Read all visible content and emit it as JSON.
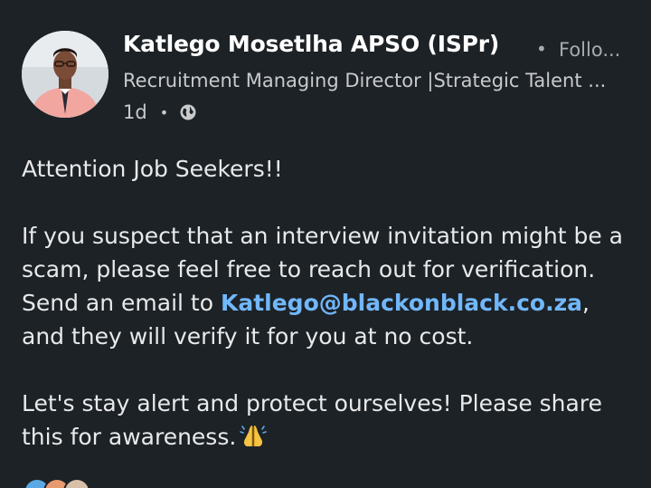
{
  "author": {
    "name": "Katlego Mosetlha APSO (ISPr)",
    "follow_label": "Follo...",
    "headline": "Recruitment Managing Director |Strategic Talent ...",
    "time": "1d"
  },
  "post": {
    "line1": "Attention Job Seekers!!",
    "para2_a": "If you suspect that an interview invitation might be a scam, please feel free to reach out for verification. Send an email to ",
    "email": "Katlego@blackonblack.co.za",
    "para2_b": ", and they will verify it for you at no cost.",
    "para3": "Let's stay alert and protect ourselves! Please share this for awareness."
  },
  "icons": {
    "globe": "globe-icon",
    "pray": "folded-hands-emoji",
    "avatar": "profile-photo"
  },
  "colors": {
    "background": "#1d2226",
    "link": "#71b7fb",
    "muted": "#a7acb0"
  }
}
